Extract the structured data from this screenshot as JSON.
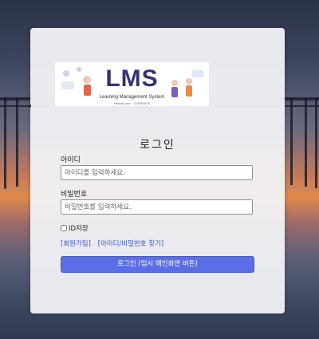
{
  "logo": {
    "title": "LMS",
    "subtitle": "Learning Management System",
    "url": "freepik.com · 123RF9876"
  },
  "login": {
    "title": "로그인",
    "id_label": "아이디",
    "id_placeholder": "아이디를 입력하세요.",
    "id_value": "",
    "pw_label": "비밀번호",
    "pw_placeholder": "비밀번호를 입력하세요.",
    "pw_value": "",
    "remember_label": "ID저장",
    "remember_checked": false,
    "signup_link": "[회원가입]",
    "find_link": "[아이디/비밀번호 찾기]",
    "submit_label": "로그인 (임시 메인화면 버튼)"
  },
  "colors": {
    "button": "#5b6ee5",
    "link": "#3d58c8",
    "logo_text": "#33327a"
  }
}
